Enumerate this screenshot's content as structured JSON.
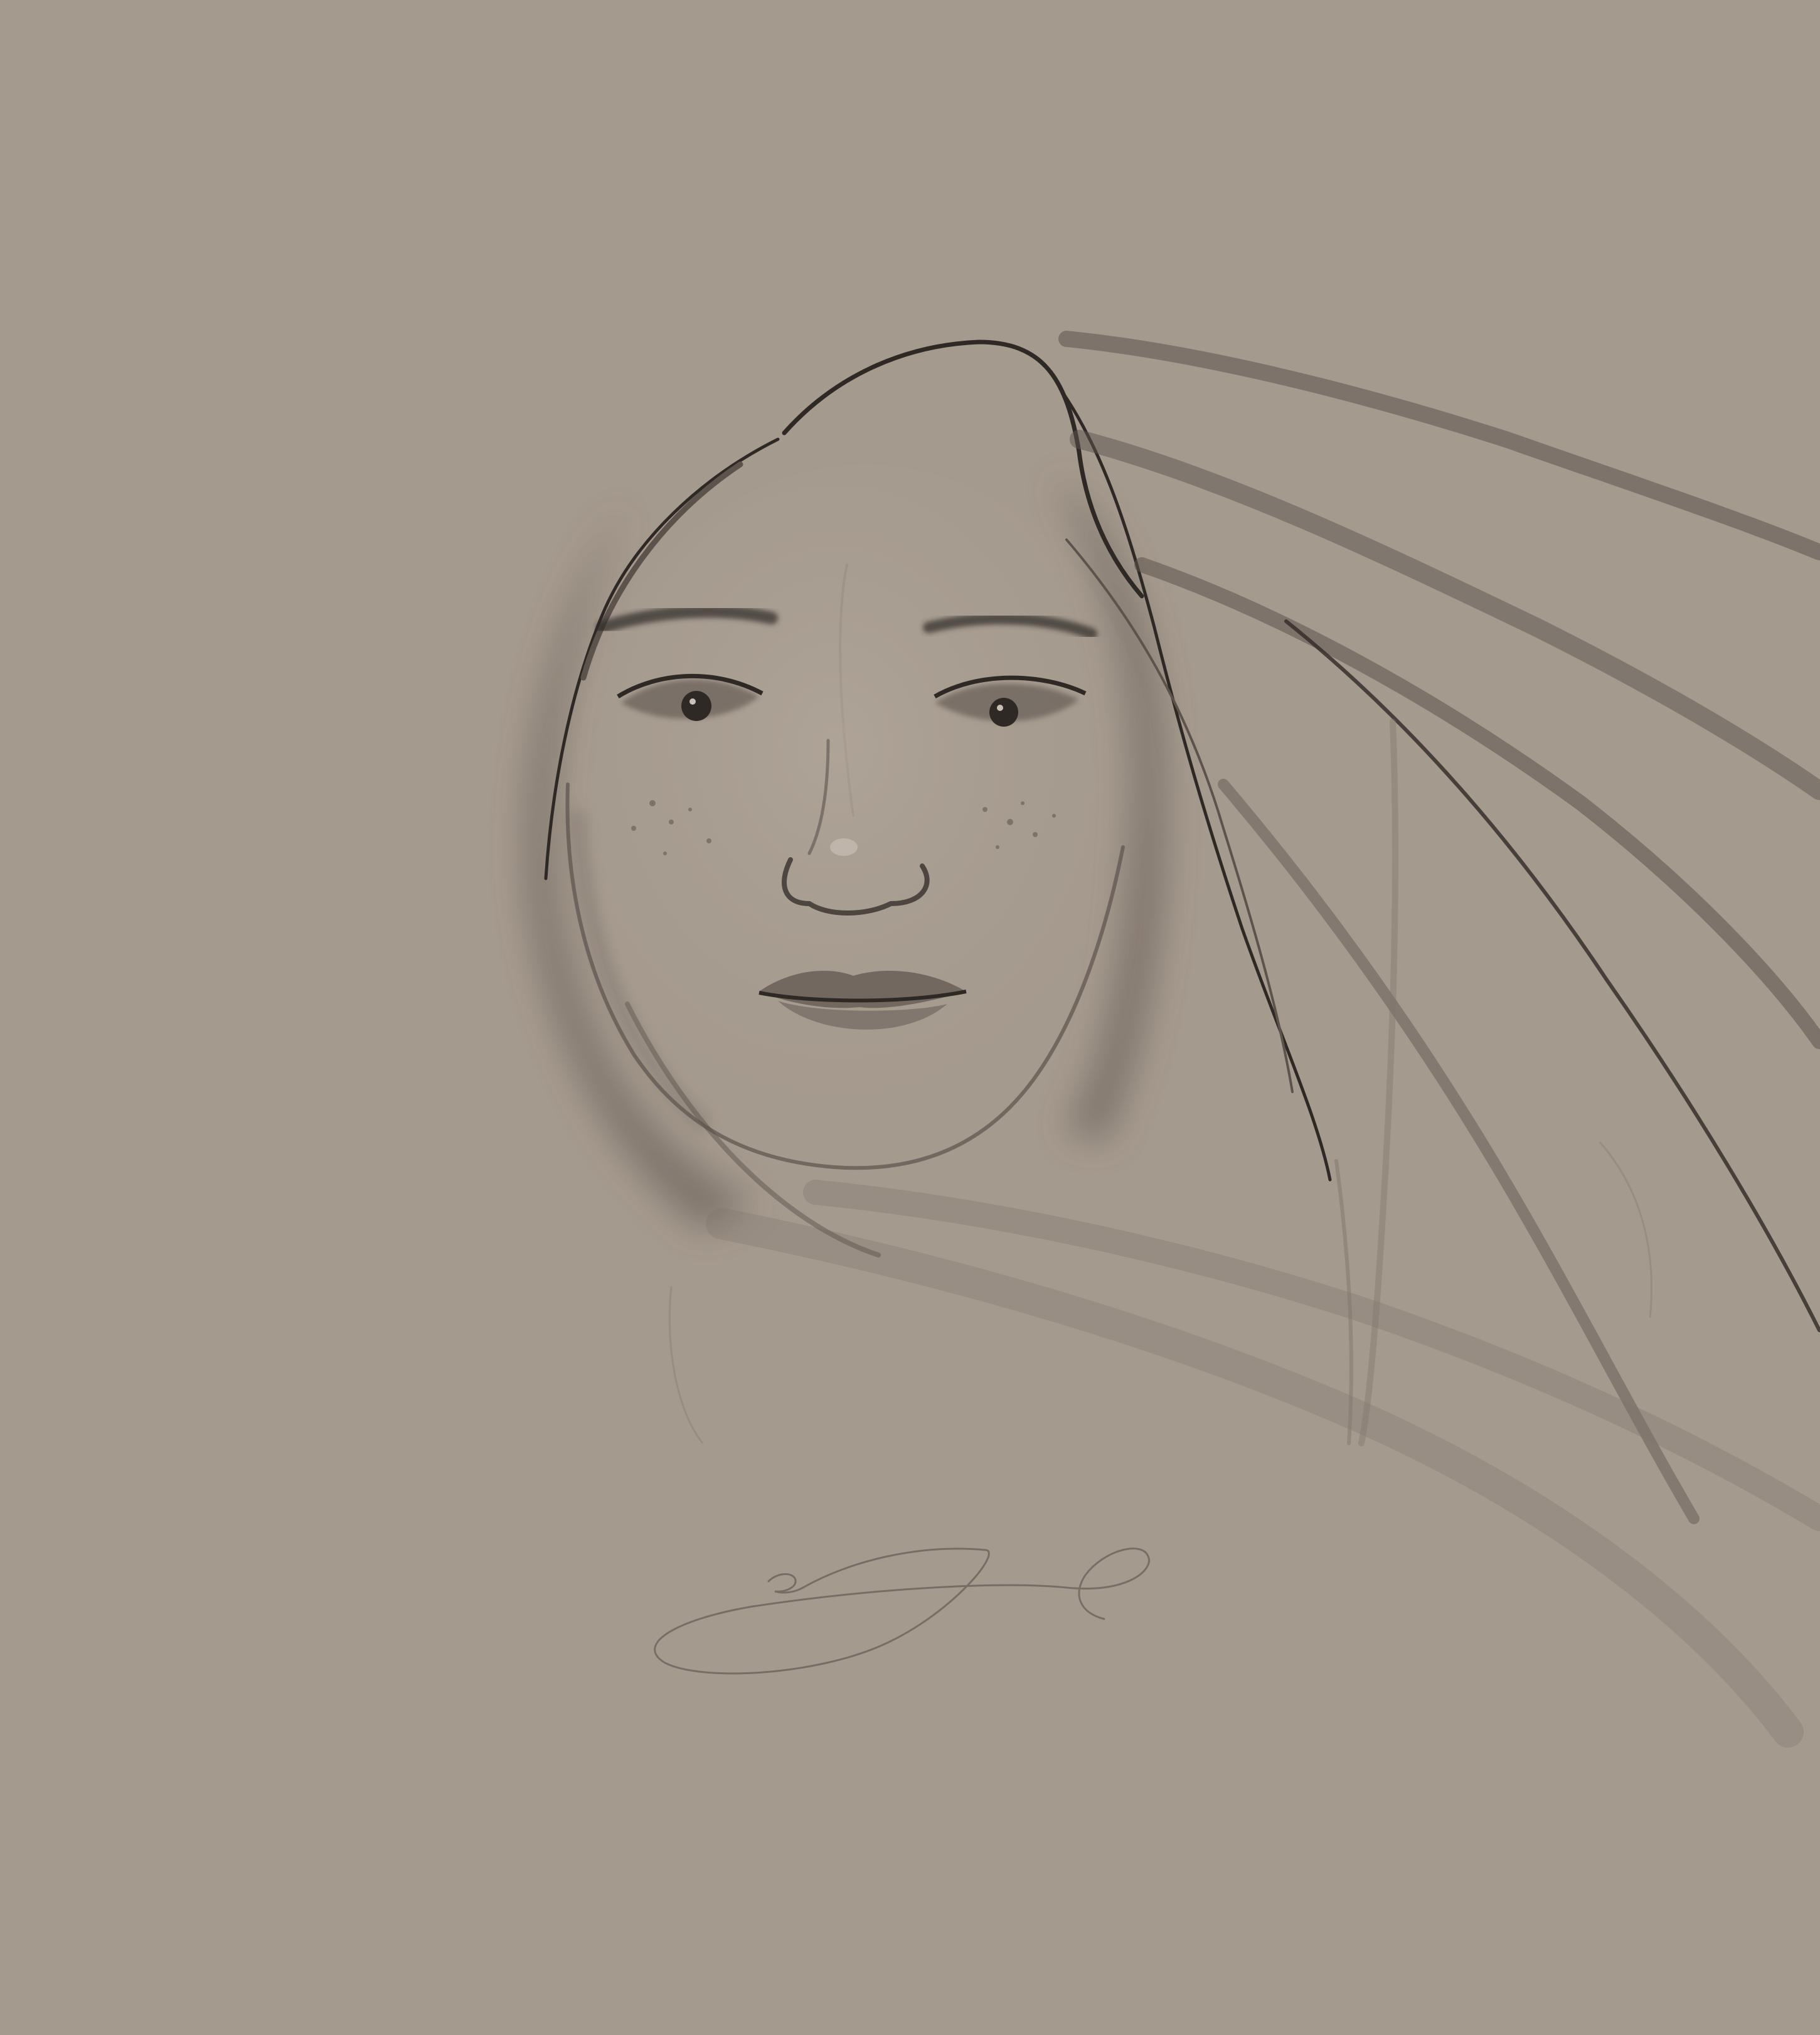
{
  "artwork": {
    "subject": "pencil-sketch-portrait",
    "palette": {
      "background": "#a59a8e",
      "graphite_dark": "#2f2926",
      "graphite_mid": "#5c534d",
      "graphite_light": "#7f756c",
      "skin_highlight": "#b9afa5",
      "lip_tone": "#6a5f58"
    }
  },
  "signature": {
    "kind": "handwritten-signature"
  }
}
